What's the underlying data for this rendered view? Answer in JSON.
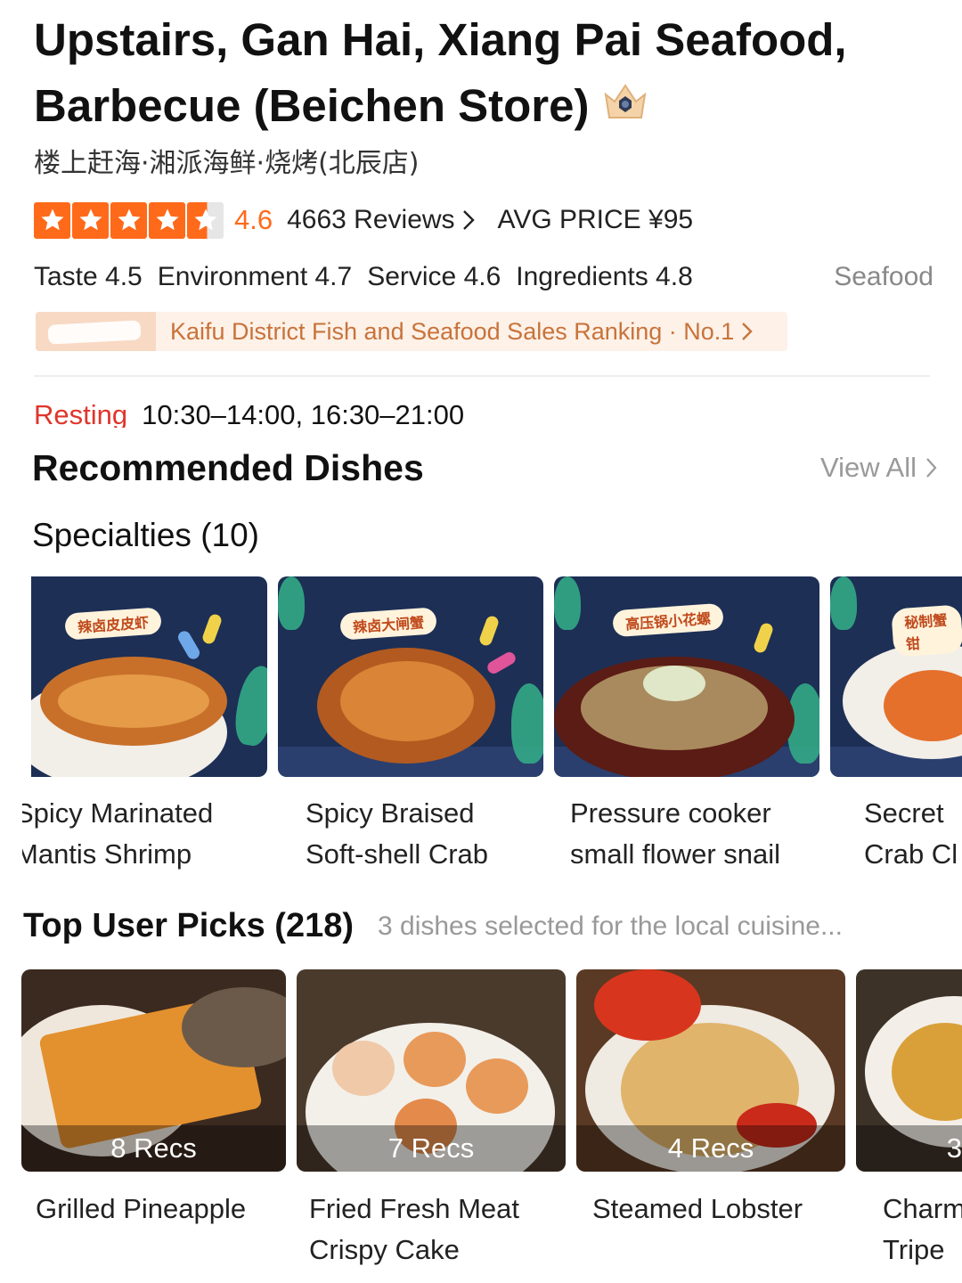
{
  "restaurant": {
    "title": "Upstairs, Gan Hai, Xiang Pai Seafood, Barbecue (Beichen Store)",
    "title_line1": "Upstairs, Gan Hai, Xiang Pai Seafood,",
    "title_line2": "Barbecue (Beichen Store)",
    "subtitle": "楼上赶海·湘派海鲜·烧烤(北辰店)",
    "rating_stars": 4.6,
    "score": "4.6",
    "reviews": "4663 Reviews",
    "avg_price": "AVG PRICE ¥95",
    "colors": {
      "accent": "#ff6a1a",
      "status": "#e0352b",
      "ranking_text": "#c8733a"
    }
  },
  "subscores": [
    {
      "label": "Taste 4.5"
    },
    {
      "label": "Environment 4.7"
    },
    {
      "label": "Service 4.6"
    },
    {
      "label": "Ingredients 4.8"
    }
  ],
  "category": "Seafood",
  "ranking": {
    "text": "Kaifu District Fish and Seafood Sales Ranking · No.1"
  },
  "hours": {
    "status": "Resting",
    "time": "10:30–14:00, 16:30–21:00"
  },
  "recommended": {
    "title": "Recommended Dishes",
    "view_all": "View All"
  },
  "specialties": {
    "title": "Specialties (10)",
    "items": [
      {
        "name_line1": "Spicy Marinated",
        "name_line2": "Mantis Shrimp"
      },
      {
        "name_line1": "Spicy Braised",
        "name_line2": "Soft-shell Crab"
      },
      {
        "name_line1": "Pressure cooker",
        "name_line2": "small flower snail"
      },
      {
        "name_line1": "Secret",
        "name_line2": "Crab Cl"
      }
    ]
  },
  "top_picks": {
    "title": "Top User Picks (218)",
    "subtitle": "3 dishes selected for the local cuisine...",
    "items": [
      {
        "recs": "8 Recs",
        "name_line1": "Grilled Pineapple",
        "name_line2": ""
      },
      {
        "recs": "7 Recs",
        "name_line1": "Fried Fresh Meat",
        "name_line2": "Crispy Cake"
      },
      {
        "recs": "4 Recs",
        "name_line1": "Steamed Lobster",
        "name_line2": ""
      },
      {
        "recs": "3",
        "name_line1": "Charm",
        "name_line2": "Tripe"
      }
    ]
  },
  "icons": [
    "crown-icon",
    "star-icon",
    "chevron-right-icon"
  ]
}
